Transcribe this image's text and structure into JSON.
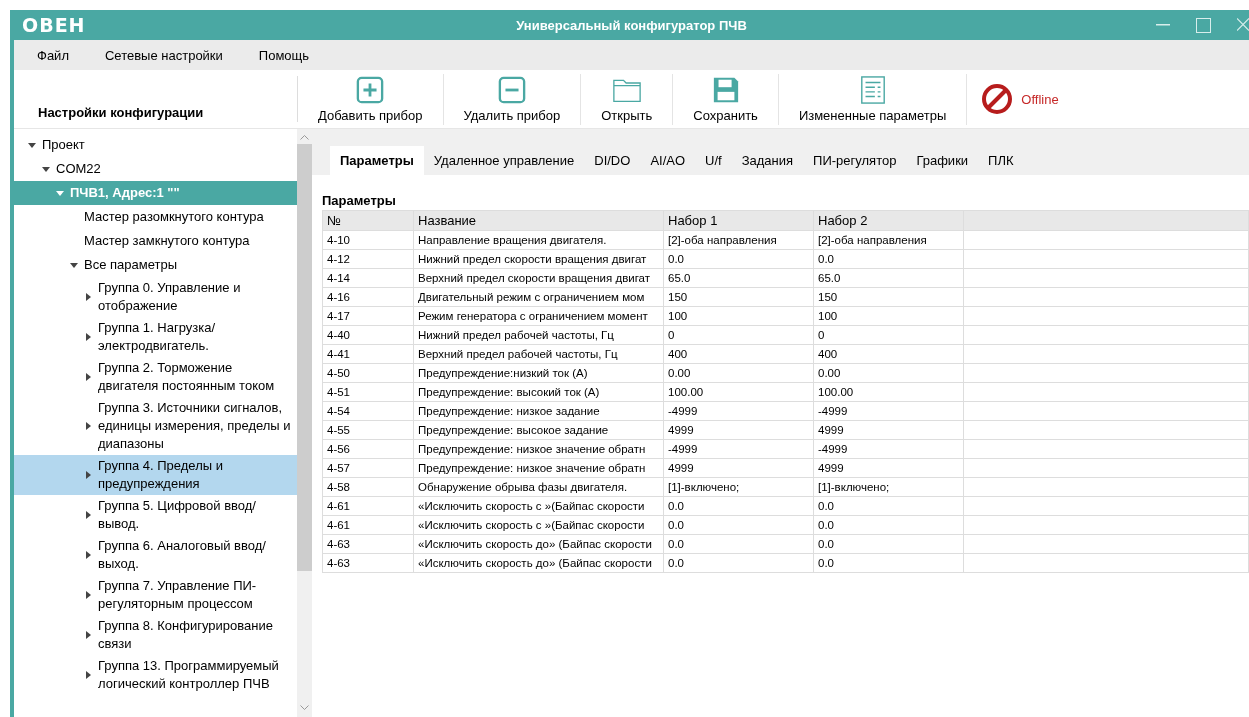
{
  "window": {
    "logo": "ОВЕН",
    "title": "Универсальный конфигуратор ПЧВ"
  },
  "menu": [
    "Файл",
    "Сетевые настройки",
    "Помощь"
  ],
  "sidebar": {
    "title": "Настройки конфигурации",
    "tree": [
      {
        "label": "Проект",
        "active": false,
        "expanded": true,
        "selected": false,
        "children": [
          {
            "label": "COM22",
            "active": false,
            "expanded": true,
            "selected": false,
            "children": [
              {
                "label": "ПЧВ1, Адрес:1 \"\"",
                "active": true,
                "expanded": true,
                "selected": false,
                "children": [
                  {
                    "label": "Мастер разомкнутого контура",
                    "active": false,
                    "selected": false
                  },
                  {
                    "label": "Мастер замкнутого контура",
                    "active": false,
                    "selected": false
                  },
                  {
                    "label": "Все параметры",
                    "active": false,
                    "expanded": true,
                    "selected": false,
                    "children": [
                      {
                        "label": "Группа 0. Управление и отображение",
                        "active": false,
                        "expanded": false,
                        "selected": false
                      },
                      {
                        "label": "Группа 1. Нагрузка/ электродвигатель.",
                        "active": false,
                        "expanded": false,
                        "selected": false
                      },
                      {
                        "label": "Группа 2. Торможение двигателя постоянным током",
                        "active": false,
                        "expanded": false,
                        "selected": false
                      },
                      {
                        "label": "Группа 3. Источники сигналов, единицы измерения, пределы и диапазоны",
                        "active": false,
                        "expanded": false,
                        "selected": false
                      },
                      {
                        "label": "Группа 4. Пределы и предупреждения",
                        "active": false,
                        "expanded": false,
                        "selected": true
                      },
                      {
                        "label": "Группа 5. Цифровой ввод/ вывод.",
                        "active": false,
                        "expanded": false,
                        "selected": false
                      },
                      {
                        "label": "Группа 6. Аналоговый ввод/ выход.",
                        "active": false,
                        "expanded": false,
                        "selected": false
                      },
                      {
                        "label": "Группа 7. Управление ПИ-регуляторным процессом",
                        "active": false,
                        "expanded": false,
                        "selected": false
                      },
                      {
                        "label": "Группа 8. Конфигурирование связи",
                        "active": false,
                        "expanded": false,
                        "selected": false
                      },
                      {
                        "label": "Группа 13. Программируемый логический контроллер ПЧВ",
                        "active": false,
                        "expanded": false,
                        "selected": false
                      }
                    ]
                  }
                ]
              }
            ]
          }
        ]
      }
    ]
  },
  "toolbar": [
    {
      "label": "Добавить прибор",
      "kind": "add"
    },
    {
      "label": "Удалить прибор",
      "kind": "remove"
    },
    {
      "label": "Открыть",
      "kind": "open"
    },
    {
      "label": "Сохранить",
      "kind": "save"
    },
    {
      "label": "Измененные параметры",
      "kind": "list"
    }
  ],
  "status": {
    "text": "Offline"
  },
  "tabs": [
    {
      "label": "Параметры",
      "selected": true
    },
    {
      "label": "Удаленное управление",
      "selected": false
    },
    {
      "label": "DI/DO",
      "selected": false
    },
    {
      "label": "AI/AO",
      "selected": false
    },
    {
      "label": "U/f",
      "selected": false
    },
    {
      "label": "Задания",
      "selected": false
    },
    {
      "label": "ПИ-регулятор",
      "selected": false
    },
    {
      "label": "Графики",
      "selected": false
    },
    {
      "label": "ПЛК",
      "selected": false
    }
  ],
  "table": {
    "title": "Параметры",
    "columns": [
      "№",
      "Название",
      "Набор 1",
      "Набор 2"
    ],
    "rows": [
      [
        "4-10",
        "Направление вращения двигателя.",
        "[2]-оба направления",
        "[2]-оба направления"
      ],
      [
        "4-12",
        "Нижний предел скорости вращения двигат",
        "0.0",
        "0.0"
      ],
      [
        "4-14",
        "Верхний предел скорости вращения двигат",
        "65.0",
        "65.0"
      ],
      [
        "4-16",
        "Двигательный режим с ограничением мом",
        "150",
        "150"
      ],
      [
        "4-17",
        "Режим генератора с ограничением момент",
        "100",
        "100"
      ],
      [
        "4-40",
        "Нижний предел рабочей частоты, Гц",
        "0",
        "0"
      ],
      [
        "4-41",
        "Верхний предел рабочей частоты, Гц",
        "400",
        "400"
      ],
      [
        "4-50",
        "Предупреждение:низкий ток (А)",
        "0.00",
        "0.00"
      ],
      [
        "4-51",
        "Предупреждение: высокий ток (А)",
        "100.00",
        "100.00"
      ],
      [
        "4-54",
        "Предупреждение: низкое задание",
        "-4999",
        "-4999"
      ],
      [
        "4-55",
        "Предупреждение: высокое задание",
        "4999",
        "4999"
      ],
      [
        "4-56",
        "Предупреждение: низкое значение обратн",
        "-4999",
        "-4999"
      ],
      [
        "4-57",
        "Предупреждение: низкое значение обратн",
        "4999",
        "4999"
      ],
      [
        "4-58",
        "Обнаружение обрыва фазы двигателя.",
        "[1]-включено;",
        "[1]-включено;"
      ],
      [
        "4-61",
        "«Исключить скорость с »(Байпас скорости",
        "0.0",
        "0.0"
      ],
      [
        "4-61",
        "«Исключить скорость с »(Байпас скорости",
        "0.0",
        "0.0"
      ],
      [
        "4-63",
        "«Исключить скорость до» (Байпас скорости",
        "0.0",
        "0.0"
      ],
      [
        "4-63",
        "«Исключить скорость до» (Байпас скорости",
        "0.0",
        "0.0"
      ]
    ]
  }
}
